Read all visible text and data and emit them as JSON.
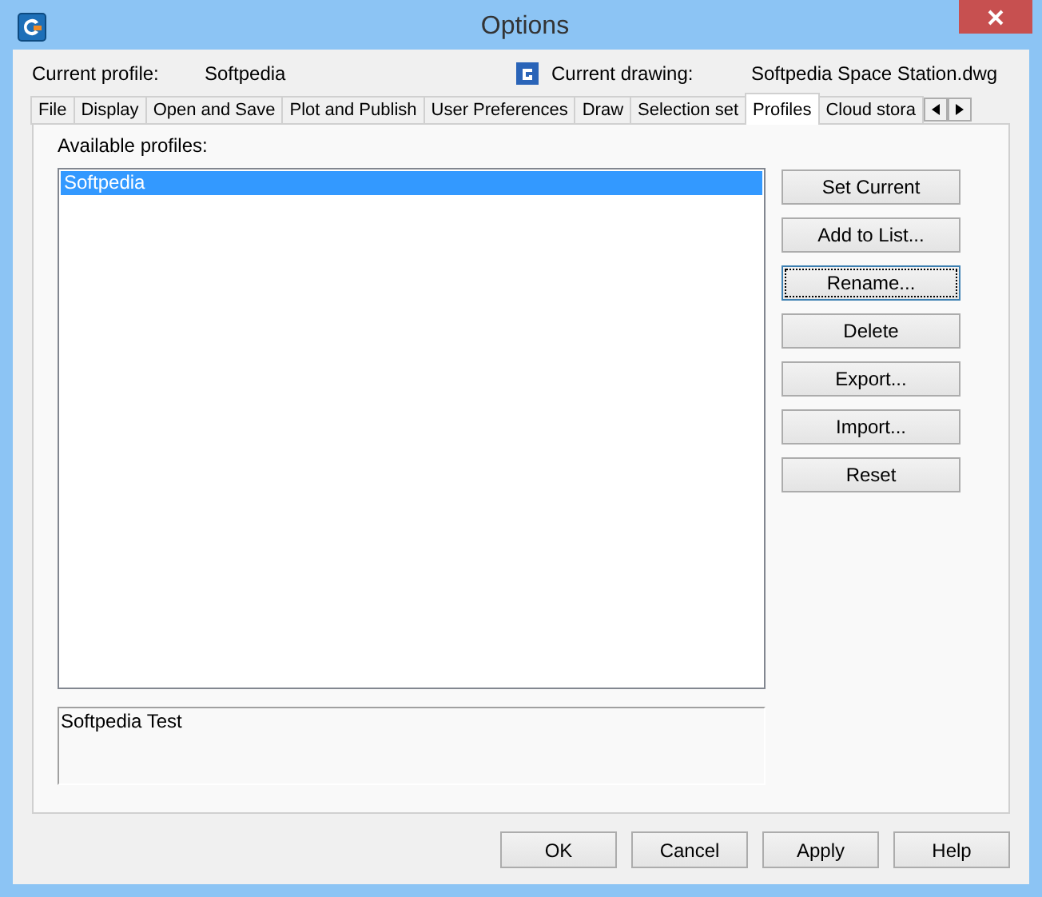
{
  "window": {
    "title": "Options"
  },
  "header": {
    "profile_label": "Current profile:",
    "profile_value": "Softpedia",
    "drawing_label": "Current drawing:",
    "drawing_value": "Softpedia Space Station.dwg"
  },
  "tabs": [
    {
      "label": "File",
      "selected": false
    },
    {
      "label": "Display",
      "selected": false
    },
    {
      "label": "Open and Save",
      "selected": false
    },
    {
      "label": "Plot and Publish",
      "selected": false
    },
    {
      "label": "User Preferences",
      "selected": false
    },
    {
      "label": "Draw",
      "selected": false
    },
    {
      "label": "Selection set",
      "selected": false
    },
    {
      "label": "Profiles",
      "selected": true
    },
    {
      "label": "Cloud stora",
      "selected": false
    }
  ],
  "profiles": {
    "label": "Available profiles:",
    "items": [
      {
        "label": "Softpedia",
        "selected": true
      }
    ],
    "description": "Softpedia Test"
  },
  "side_buttons": [
    {
      "label": "Set Current",
      "focused": false
    },
    {
      "label": "Add to List...",
      "focused": false
    },
    {
      "label": "Rename...",
      "focused": true
    },
    {
      "label": "Delete",
      "focused": false
    },
    {
      "label": "Export...",
      "focused": false
    },
    {
      "label": "Import...",
      "focused": false
    },
    {
      "label": "Reset",
      "focused": false
    }
  ],
  "buttons": [
    "OK",
    "Cancel",
    "Apply",
    "Help"
  ]
}
